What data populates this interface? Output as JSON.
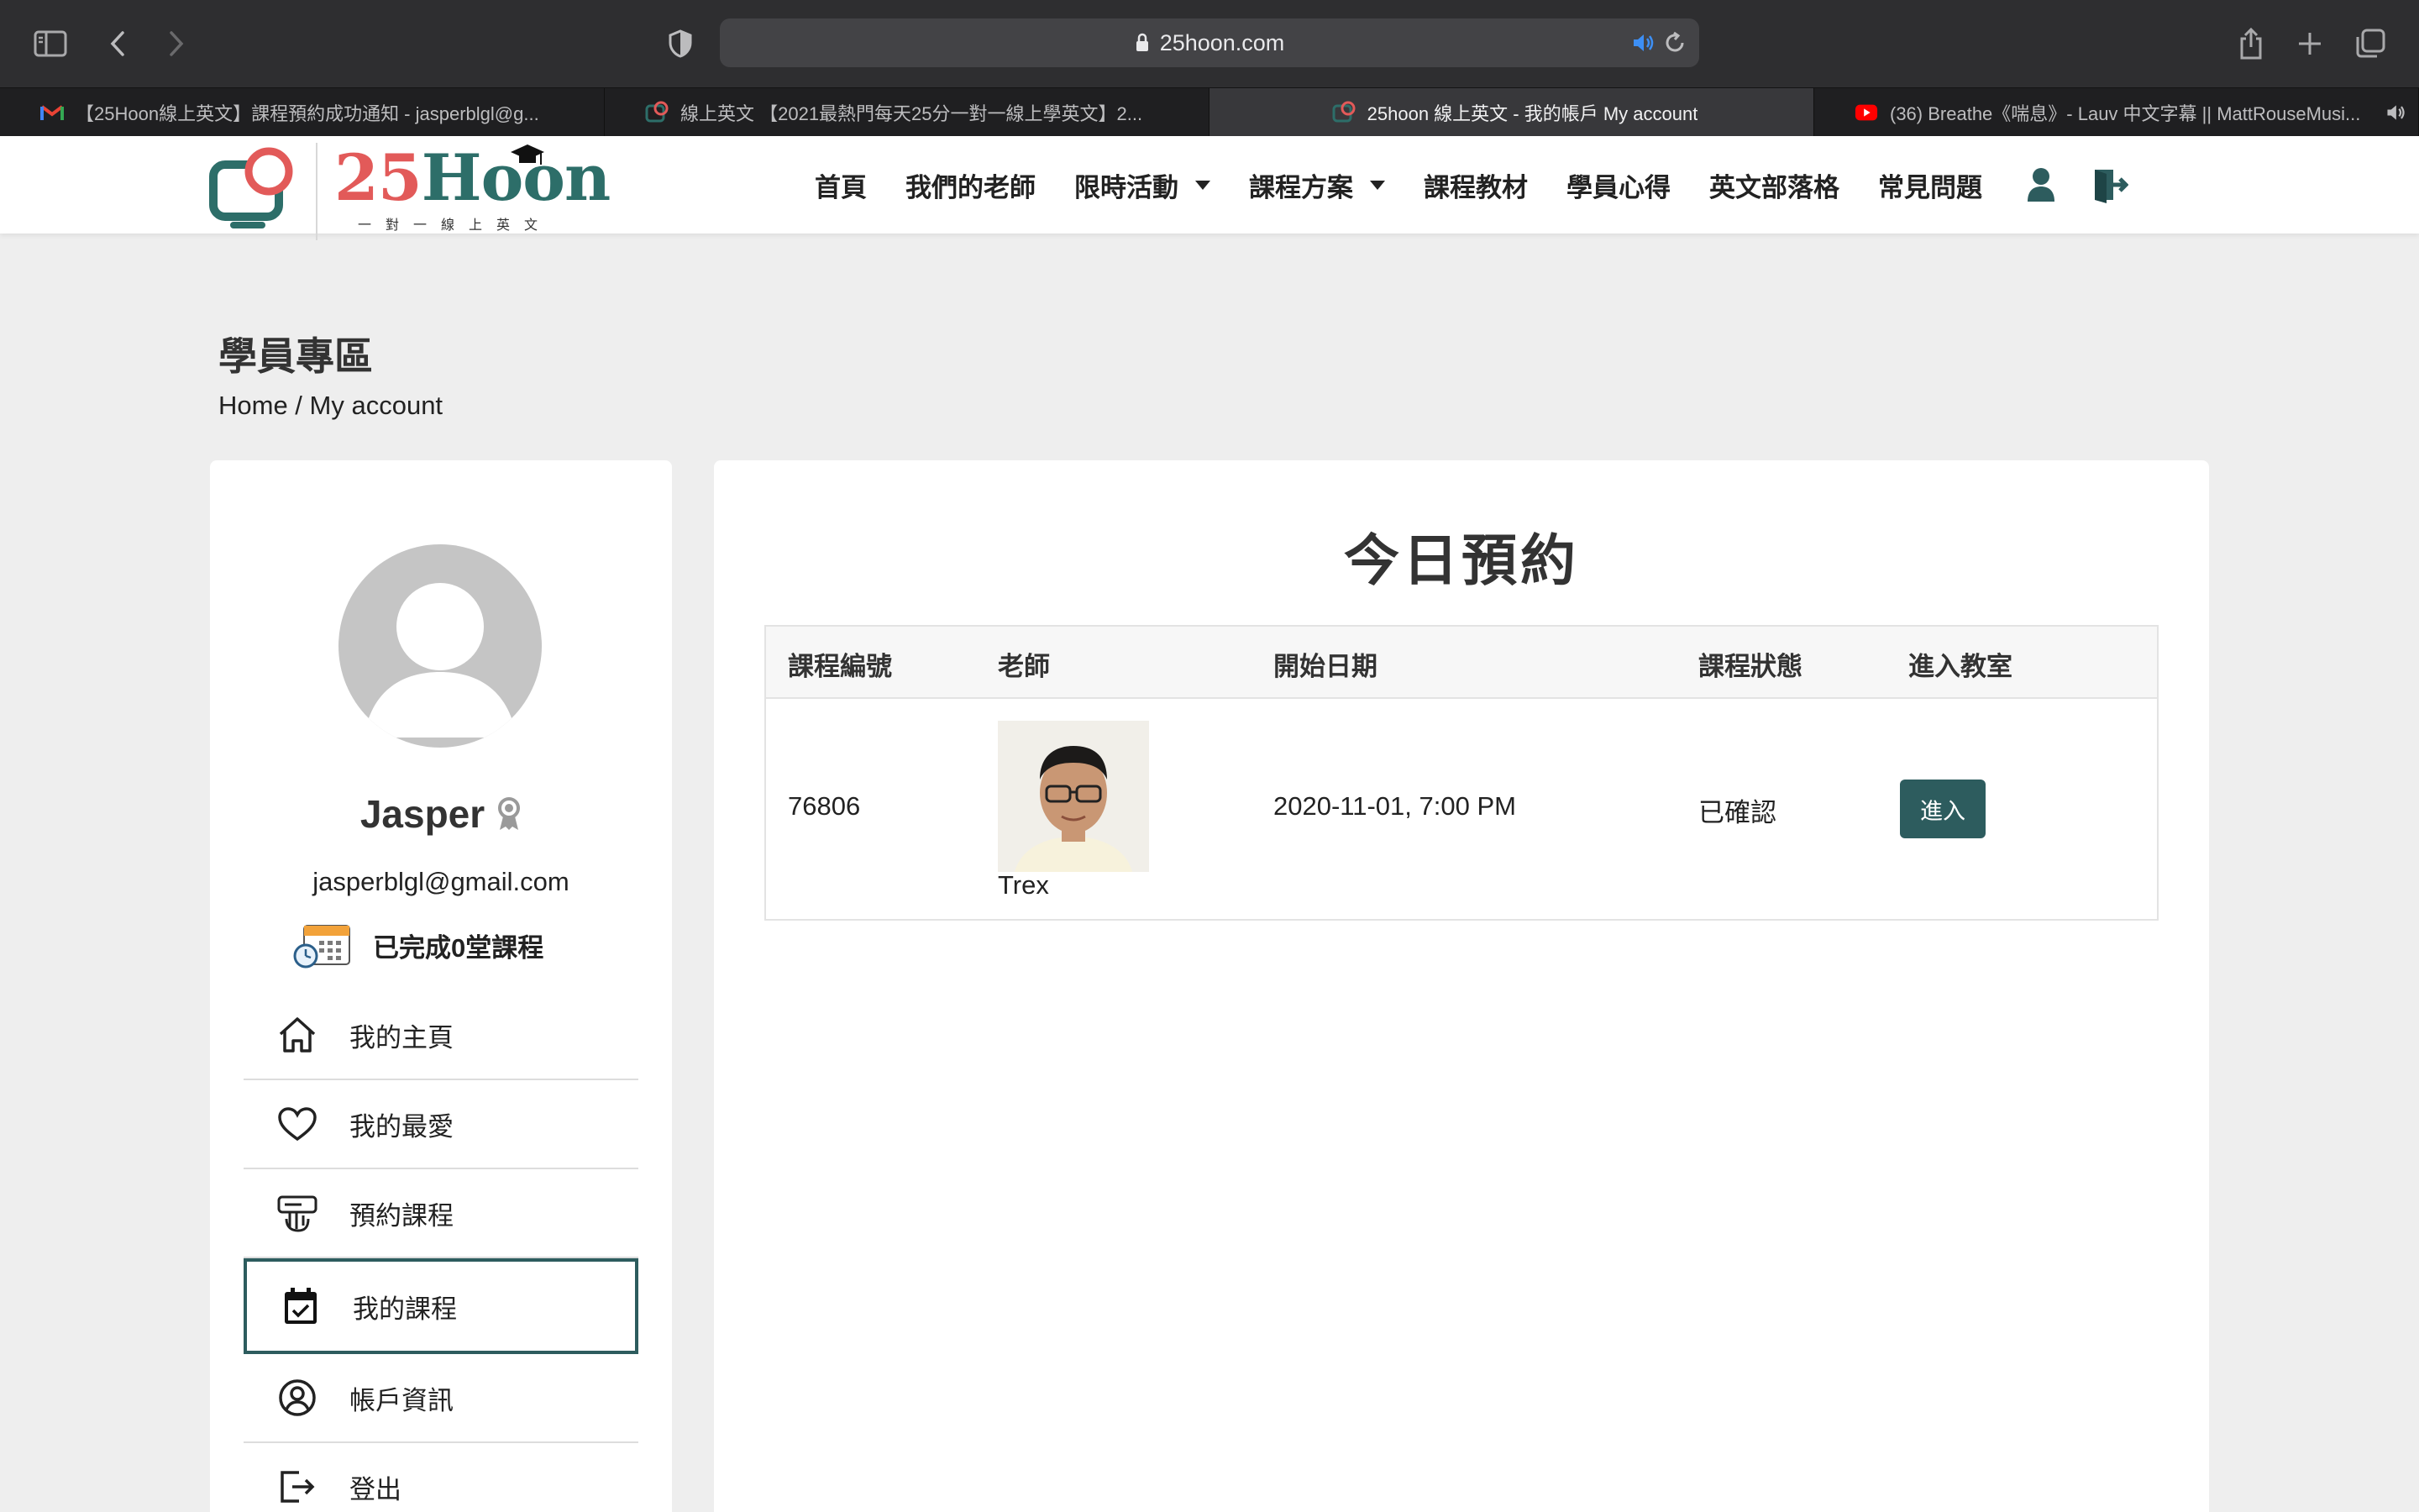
{
  "browser": {
    "url": "25hoon.com",
    "tabs": [
      {
        "title": "【25Hoon線上英文】課程預約成功通知 - jasperblgl@g...",
        "active": false,
        "favicon": "gmail-icon"
      },
      {
        "title": "線上英文 【2021最熱門每天25分一對一線上學英文】2...",
        "active": false,
        "favicon": "25hoon-icon"
      },
      {
        "title": "25hoon 線上英文 - 我的帳戶 My account",
        "active": true,
        "favicon": "25hoon-icon"
      },
      {
        "title": "(36) Breathe《喘息》- Lauv 中文字幕 || MattRouseMusi...",
        "active": false,
        "favicon": "youtube-icon"
      }
    ]
  },
  "header": {
    "logo_num": "25",
    "logo_word": "Hoon",
    "logo_sub": "一對一線上英文",
    "nav": [
      {
        "label": "首頁",
        "caret": false
      },
      {
        "label": "我們的老師",
        "caret": false
      },
      {
        "label": "限時活動",
        "caret": true
      },
      {
        "label": "課程方案",
        "caret": true
      },
      {
        "label": "課程教材",
        "caret": false
      },
      {
        "label": "學員心得",
        "caret": false
      },
      {
        "label": "英文部落格",
        "caret": false
      },
      {
        "label": "常見問題",
        "caret": false
      }
    ]
  },
  "page": {
    "title": "學員專區",
    "breadcrumb": "Home / My account"
  },
  "profile": {
    "name": "Jasper",
    "email": "jasperblgl@gmail.com",
    "completed": "已完成0堂課程"
  },
  "menu": [
    {
      "label": "我的主頁",
      "icon": "home-icon",
      "active": false
    },
    {
      "label": "我的最愛",
      "icon": "heart-icon",
      "active": false
    },
    {
      "label": "預約課程",
      "icon": "booking-icon",
      "active": false
    },
    {
      "label": "我的課程",
      "icon": "calendar-check-icon",
      "active": true
    },
    {
      "label": "帳戶資訊",
      "icon": "user-circle-icon",
      "active": false
    },
    {
      "label": "登出",
      "icon": "logout-icon",
      "active": false
    }
  ],
  "main": {
    "title": "今日預約",
    "table": {
      "headers": [
        "課程編號",
        "老師",
        "開始日期",
        "課程狀態",
        "進入教室"
      ],
      "rows": [
        {
          "id": "76806",
          "teacher": "Trex",
          "start": "2020-11-01, 7:00 PM",
          "status": "已確認",
          "action": "進入"
        }
      ]
    }
  },
  "colors": {
    "brand_teal": "#2d5c5e",
    "logo_red": "#e25a59",
    "logo_green": "#2d6e69"
  }
}
